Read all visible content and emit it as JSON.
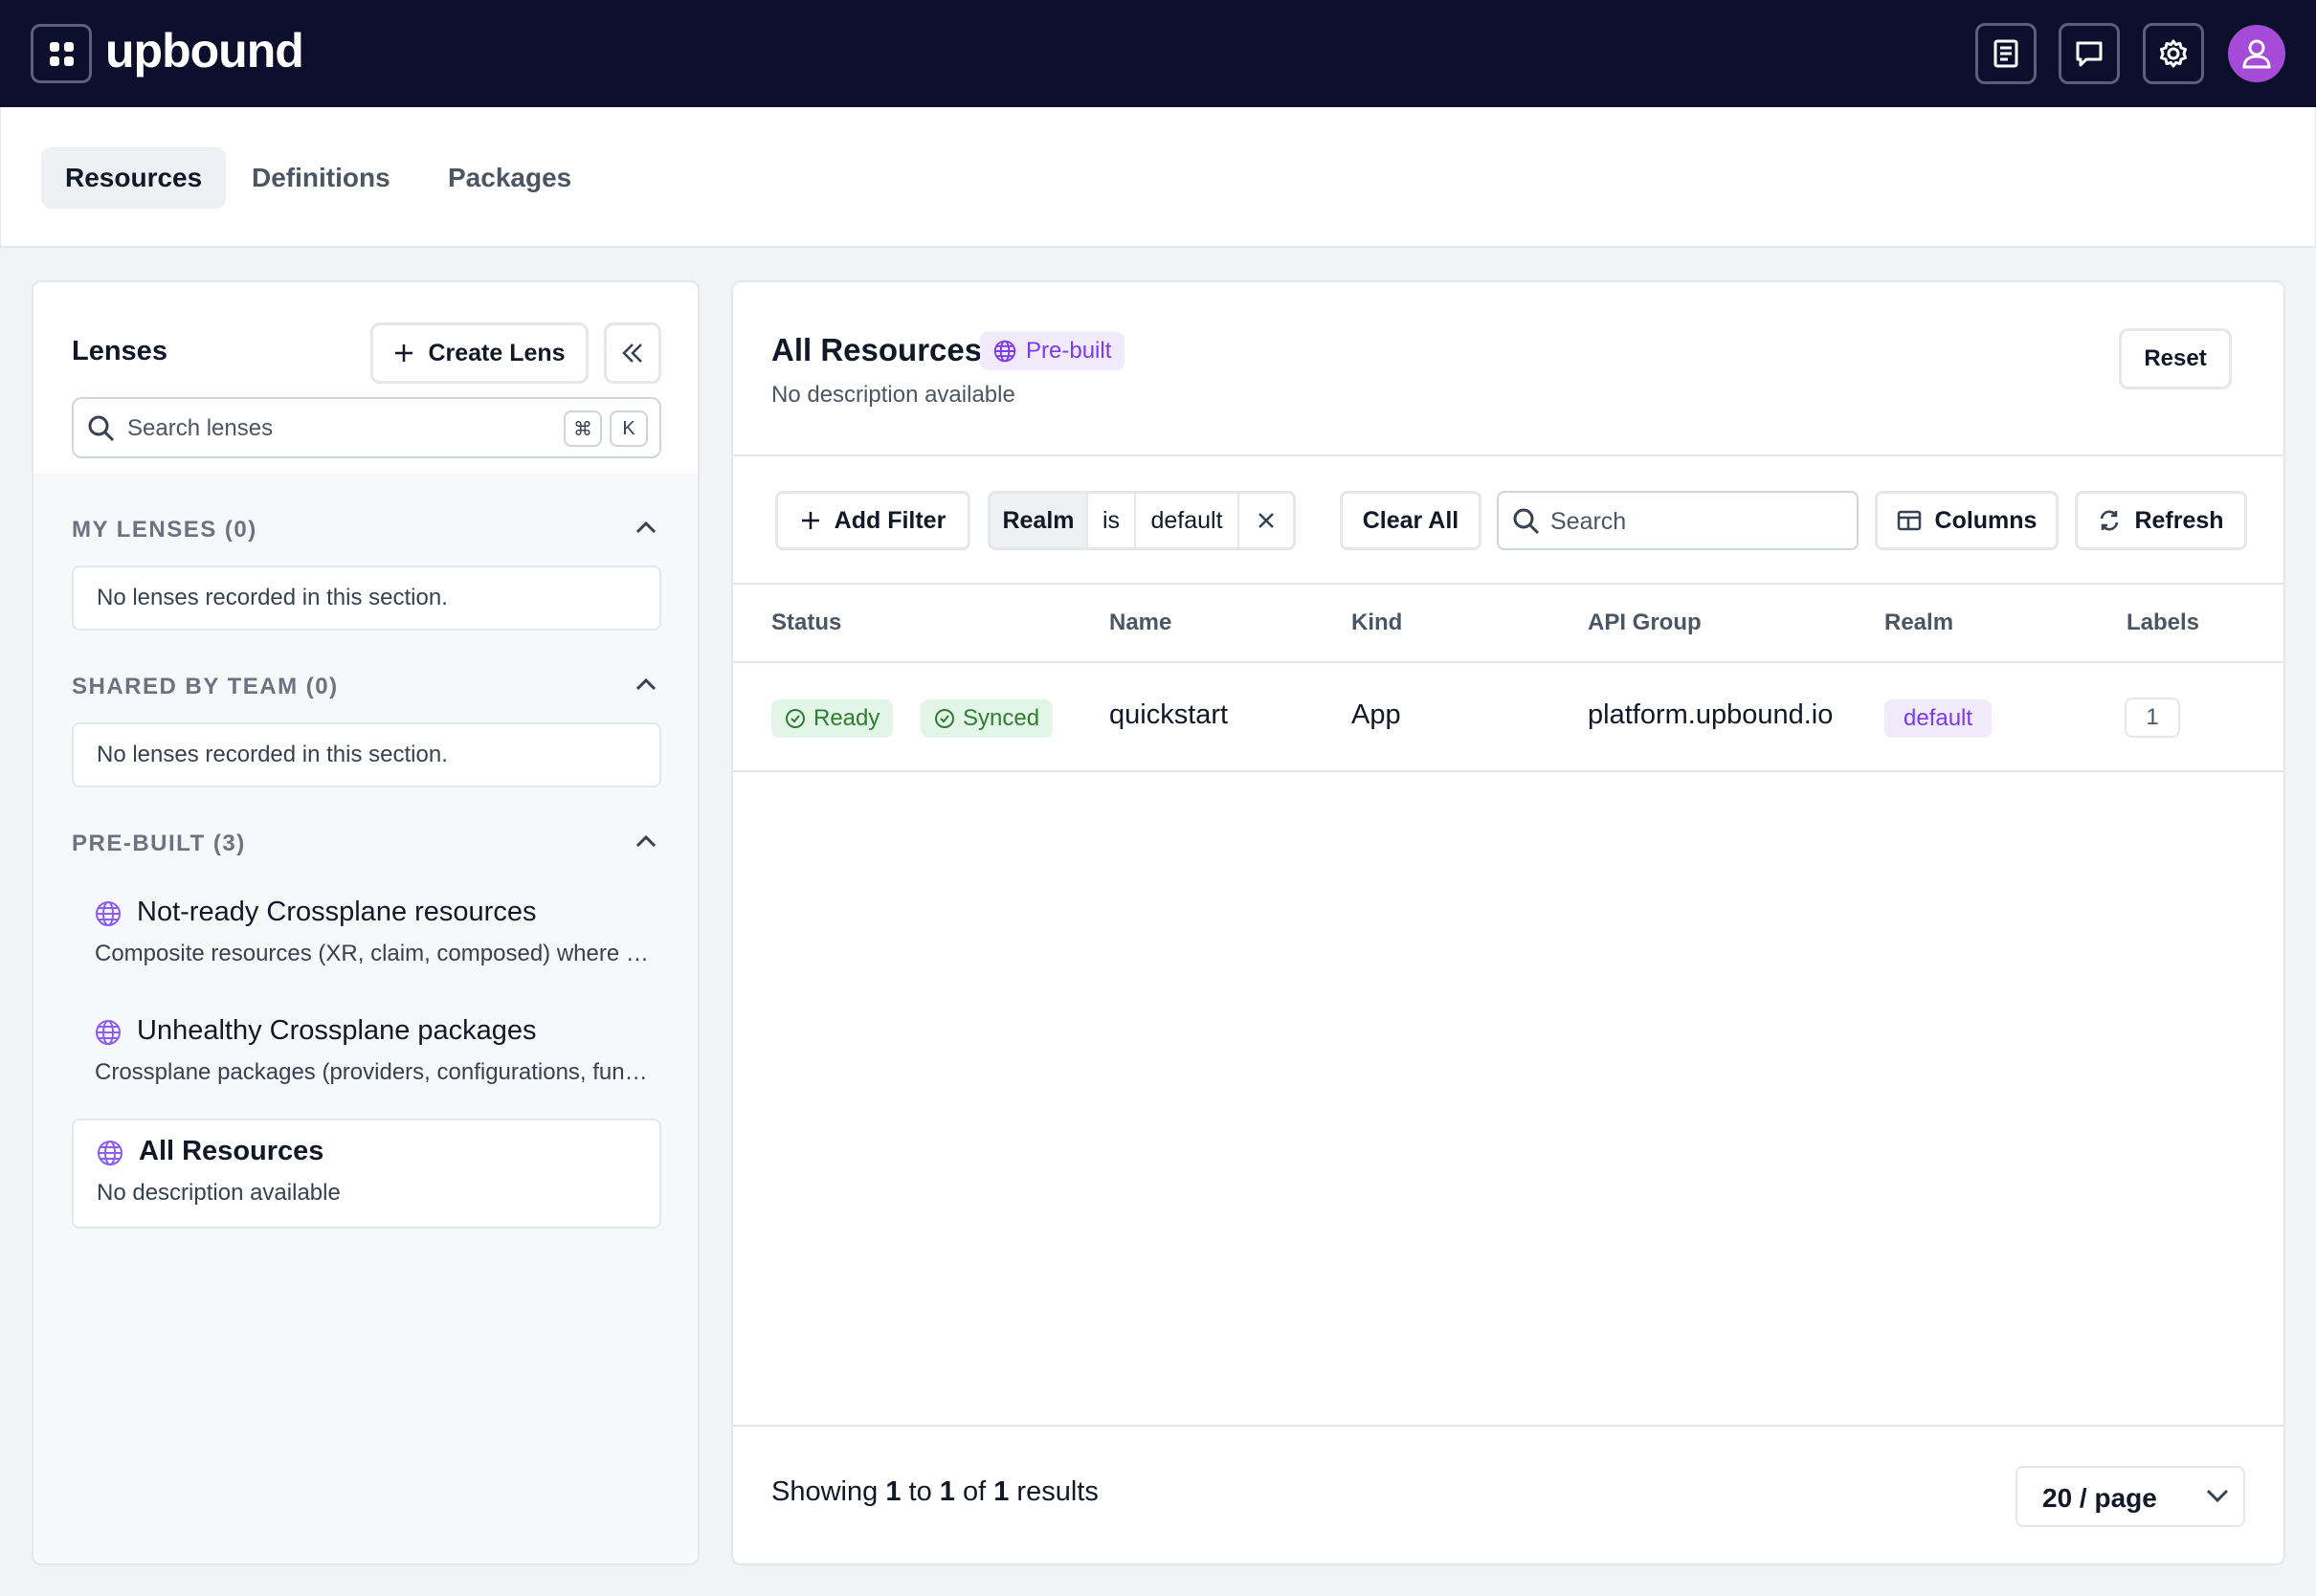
{
  "topbar": {
    "logo": "upbound",
    "icons": [
      "docs-icon",
      "feedback-icon",
      "settings-icon",
      "user-avatar-icon"
    ]
  },
  "tabs": [
    {
      "label": "Resources",
      "active": true
    },
    {
      "label": "Definitions",
      "active": false
    },
    {
      "label": "Packages",
      "active": false
    }
  ],
  "lenses": {
    "title": "Lenses",
    "create_label": "Create Lens",
    "search_placeholder": "Search lenses",
    "shortcut_keys": [
      "⌘",
      "K"
    ],
    "sections": [
      {
        "heading": "MY LENSES (0)",
        "empty_text": "No lenses recorded in this section."
      },
      {
        "heading": "SHARED BY TEAM (0)",
        "empty_text": "No lenses recorded in this section."
      },
      {
        "heading": "PRE-BUILT (3)"
      }
    ],
    "prebuilt": [
      {
        "name": "Not-ready Crossplane resources",
        "desc": "Composite resources (XR, claim, composed) where status conditions are not ready"
      },
      {
        "name": "Unhealthy Crossplane packages",
        "desc": "Crossplane packages (providers, configurations, functions) that are unhealthy"
      },
      {
        "name": "All Resources",
        "desc": "No description available",
        "selected": true
      }
    ]
  },
  "main": {
    "title": "All Resources",
    "badge": "Pre-built",
    "description": "No description available",
    "reset_label": "Reset",
    "add_filter_label": "Add Filter",
    "filter": {
      "key": "Realm",
      "op": "is",
      "value": "default"
    },
    "clear_all_label": "Clear All",
    "search_placeholder": "Search",
    "columns_label": "Columns",
    "refresh_label": "Refresh",
    "table": {
      "headers": [
        "Status",
        "Name",
        "Kind",
        "API Group",
        "Realm",
        "Labels"
      ],
      "rows": [
        {
          "status": [
            "Ready",
            "Synced"
          ],
          "name": "quickstart",
          "kind": "App",
          "api_group": "platform.upbound.io",
          "realm": "default",
          "labels": "1"
        }
      ]
    },
    "footer": {
      "prefix": "Showing",
      "from": "1",
      "to_word": "to",
      "to": "1",
      "of_word": "of",
      "total": "1",
      "suffix": "results"
    },
    "page_size": "20 / page"
  },
  "colors": {
    "topbar": "#0b0f2b",
    "accent_purple": "#7c3aed",
    "status_green": "#2e7d32",
    "avatar": "#a54bd8"
  }
}
